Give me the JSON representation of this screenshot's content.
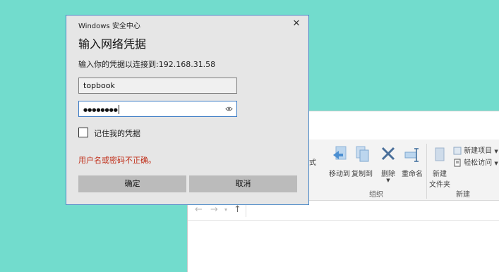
{
  "dialog": {
    "window_title": "Windows 安全中心",
    "close_glyph": "✕",
    "heading": "输入网络凭据",
    "prompt": "输入你的凭据以连接到:192.168.31.58",
    "username_value": "topbook",
    "password_mask": "●●●●●●●●",
    "remember_label": "记住我的凭据",
    "remember_checked": false,
    "error_message": "用户名或密码不正确。",
    "ok_label": "确定",
    "cancel_label": "取消"
  },
  "explorer": {
    "partial_label": "式",
    "ribbon_buttons": {
      "move_to": "移动到",
      "copy_to": "复制到",
      "delete": "删除",
      "rename": "重命名",
      "new_folder_line1": "新建",
      "new_folder_line2": "文件夹",
      "new_item": "新建项目",
      "easy_access": "轻松访问"
    },
    "groups": {
      "organize": "组织",
      "new": "新建"
    },
    "icons": [
      "move-to-icon",
      "copy-to-icon",
      "delete-icon",
      "rename-icon",
      "new-folder-icon",
      "new-item-icon",
      "easy-access-icon"
    ]
  }
}
